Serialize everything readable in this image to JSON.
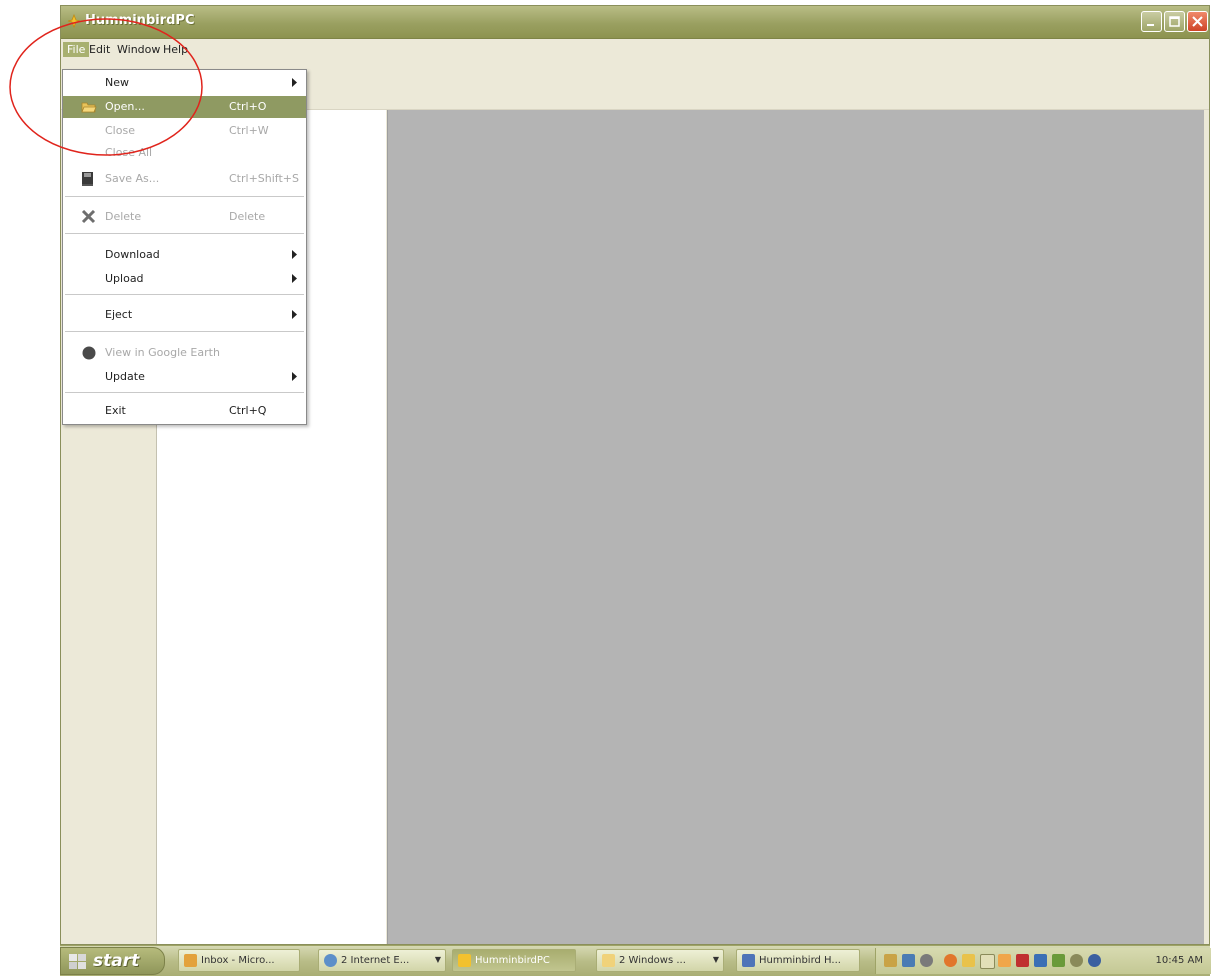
{
  "window": {
    "title": "HumminbirdPC"
  },
  "menubar": {
    "items": [
      {
        "label": "File",
        "active": true
      },
      {
        "label": "Edit"
      },
      {
        "label": "Window"
      },
      {
        "label": "Help"
      }
    ]
  },
  "file_menu": {
    "new": {
      "label": "New"
    },
    "open": {
      "label": "Open...",
      "shortcut": "Ctrl+O"
    },
    "close": {
      "label": "Close",
      "shortcut": "Ctrl+W"
    },
    "close_all": {
      "label": "Close All"
    },
    "save_as": {
      "label": "Save As...",
      "shortcut": "Ctrl+Shift+S"
    },
    "delete": {
      "label": "Delete",
      "shortcut": "Delete"
    },
    "download": {
      "label": "Download"
    },
    "upload": {
      "label": "Upload"
    },
    "eject": {
      "label": "Eject"
    },
    "google_earth": {
      "label": "View in Google Earth"
    },
    "update": {
      "label": "Update"
    },
    "exit": {
      "label": "Exit",
      "shortcut": "Ctrl+Q"
    }
  },
  "colors": {
    "titlebar": "#9aa061",
    "menu_highlight": "#8f9a62",
    "annotation": "#e0241c",
    "workspace_gray": "#b4b4b4"
  },
  "taskbar": {
    "start_label": "start",
    "tasks": [
      {
        "label": "Inbox - Micro..."
      },
      {
        "label": "2 Internet E..."
      },
      {
        "label": "HumminbirdPC"
      },
      {
        "label": "2 Windows ..."
      },
      {
        "label": "Humminbird H..."
      }
    ],
    "clock": "10:45 AM"
  }
}
